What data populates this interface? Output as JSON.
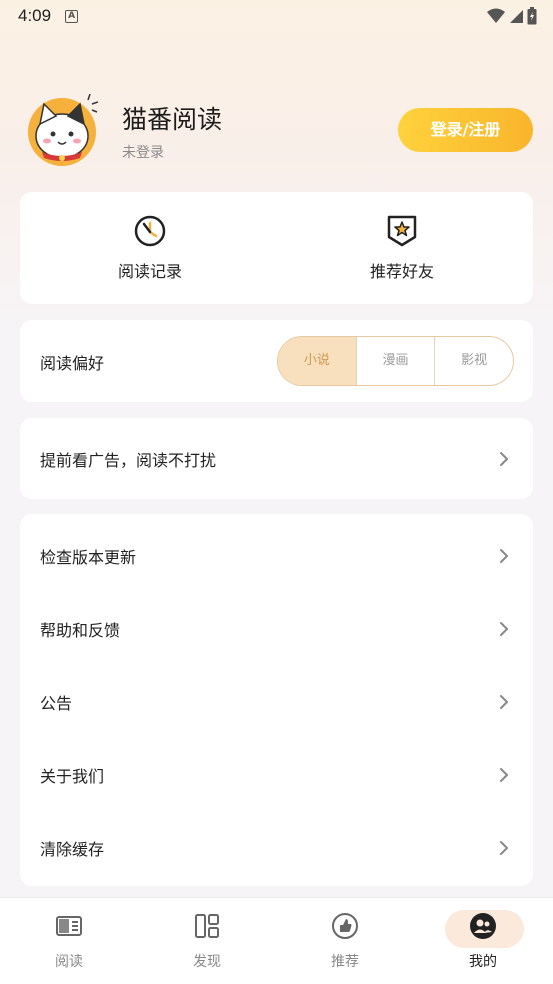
{
  "status_bar": {
    "time": "4:09",
    "notification_icon": "A"
  },
  "profile": {
    "app_name": "猫番阅读",
    "login_state": "未登录",
    "login_button": "登录/注册"
  },
  "quick_actions": [
    {
      "label": "阅读记录",
      "icon": "clock-icon"
    },
    {
      "label": "推荐好友",
      "icon": "star-badge-icon"
    }
  ],
  "preference": {
    "label": "阅读偏好",
    "options": [
      "小说",
      "漫画",
      "影视"
    ],
    "selected": "小说"
  },
  "ad_row": {
    "label": "提前看广告，阅读不打扰"
  },
  "menu": [
    {
      "label": "检查版本更新"
    },
    {
      "label": "帮助和反馈"
    },
    {
      "label": "公告"
    },
    {
      "label": "关于我们"
    },
    {
      "label": "清除缓存"
    }
  ],
  "tabbar": [
    {
      "label": "阅读",
      "icon": "book-icon"
    },
    {
      "label": "发现",
      "icon": "grid-icon"
    },
    {
      "label": "推荐",
      "icon": "thumbs-up-icon"
    },
    {
      "label": "我的",
      "icon": "profile-icon",
      "active": true
    }
  ],
  "colors": {
    "accent": "#f9b52c",
    "selected_segment": "#f8dfbd"
  }
}
